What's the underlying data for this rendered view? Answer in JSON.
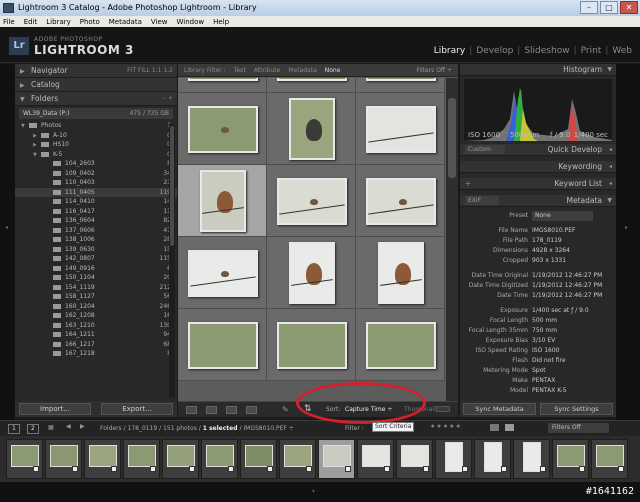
{
  "window": {
    "title": "Lightroom 3 Catalog - Adobe Photoshop Lightroom - Library",
    "buttons": [
      "–",
      "□",
      "✕"
    ]
  },
  "menu": [
    "File",
    "Edit",
    "Library",
    "Photo",
    "Metadata",
    "View",
    "Window",
    "Help"
  ],
  "brand": {
    "logo": "Lr",
    "line1": "ADOBE PHOTOSHOP",
    "line2": "LIGHTROOM 3"
  },
  "modules": [
    "Library",
    "|",
    "Develop",
    "|",
    "Slideshow",
    "|",
    "Print",
    "|",
    "Web"
  ],
  "left": {
    "navigator": {
      "title": "Navigator",
      "options": "FIT  FILL  1:1  1:2"
    },
    "catalog": "Catalog",
    "folders": {
      "title": "Folders",
      "actions": "–  +",
      "volume": {
        "name": "WL39_Data (P:)",
        "info": "475 / 735 GB"
      },
      "items": [
        {
          "name": "Photos",
          "count": "1"
        },
        {
          "name": "A-10",
          "count": "0"
        },
        {
          "name": "HS10",
          "count": "0"
        },
        {
          "name": "K-5",
          "count": "0"
        },
        {
          "name": "104_2603",
          "count": "8"
        },
        {
          "name": "109_0402",
          "count": "34"
        },
        {
          "name": "110_0403",
          "count": "23"
        },
        {
          "name": "111_0405",
          "count": "119"
        },
        {
          "name": "114_0410",
          "count": "14"
        },
        {
          "name": "116_0417",
          "count": "11"
        },
        {
          "name": "136_0604",
          "count": "82"
        },
        {
          "name": "137_0606",
          "count": "47"
        },
        {
          "name": "138_1006",
          "count": "28"
        },
        {
          "name": "139_0630",
          "count": "15"
        },
        {
          "name": "142_0807",
          "count": "115"
        },
        {
          "name": "149_0916",
          "count": "6"
        },
        {
          "name": "150_1104",
          "count": "20"
        },
        {
          "name": "154_1119",
          "count": "212"
        },
        {
          "name": "158_1127",
          "count": "56"
        },
        {
          "name": "160_1204",
          "count": "246"
        },
        {
          "name": "162_1208",
          "count": "16"
        },
        {
          "name": "163_1210",
          "count": "130"
        },
        {
          "name": "164_1211",
          "count": "94"
        },
        {
          "name": "166_1217",
          "count": "68"
        },
        {
          "name": "167_1218",
          "count": "8"
        }
      ]
    },
    "import_btn": "Import...",
    "export_btn": "Export..."
  },
  "filterbar": {
    "label": "Library Filter :",
    "options": [
      "Text",
      "Attribute",
      "Metadata",
      "None"
    ],
    "right": "Filters Off ÷"
  },
  "toolbar": {
    "sort_label": "Sort:",
    "sort_value": "Capture Time ÷",
    "thumbnails": "Thumbnail"
  },
  "right": {
    "histogram": {
      "title": "Histogram",
      "iso": "ISO 1600",
      "focal": "500 mm",
      "aperture": "f / 9.0",
      "shutter": "1/400 sec"
    },
    "quick_develop": {
      "preset": "Custom",
      "title": "Quick Develop"
    },
    "keywording": "Keywording",
    "keyword_list": "Keyword List",
    "metadata": {
      "title": "Metadata",
      "set": "EXIF",
      "preset_label": "Preset",
      "preset_value": "None",
      "rows": [
        {
          "k": "File Name",
          "v": "IMGS8010.PEF"
        },
        {
          "k": "File Path",
          "v": "178_0119"
        },
        {
          "k": "Dimensions",
          "v": "4928 x 3264"
        },
        {
          "k": "Cropped",
          "v": "903 x 1331"
        },
        {
          "k": "",
          "v": ""
        },
        {
          "k": "Date Time Original",
          "v": "1/19/2012 12:46:27 PM"
        },
        {
          "k": "Date Time Digitized",
          "v": "1/19/2012 12:46:27 PM"
        },
        {
          "k": "Date Time",
          "v": "1/19/2012 12:46:27 PM"
        },
        {
          "k": "",
          "v": ""
        },
        {
          "k": "Exposure",
          "v": "1/400 sec at ƒ / 9.0"
        },
        {
          "k": "Focal Length",
          "v": "500 mm"
        },
        {
          "k": "Focal Length 35mm",
          "v": "750 mm"
        },
        {
          "k": "Exposure Bias",
          "v": "3/10 EV"
        },
        {
          "k": "ISO Speed Rating",
          "v": "ISO 1600"
        },
        {
          "k": "Flash",
          "v": "Did not fire"
        },
        {
          "k": "Metering Mode",
          "v": "Spot"
        },
        {
          "k": "Make",
          "v": "PENTAX"
        },
        {
          "k": "Model",
          "v": "PENTAX K-5"
        }
      ]
    },
    "sync_metadata": "Sync Metadata",
    "sync_settings": "Sync Settings"
  },
  "filmstrip_bar": {
    "page1": "1",
    "page2": "2",
    "path": "Folders / 178_0119 / 151 photos / ",
    "selected": "1 selected",
    "file": " / IMGS8010.PEF ÷",
    "filter": "Filter :",
    "tooltip": "Sort Criteria",
    "filters_off": "Filters Off"
  },
  "watermark": "#1641162"
}
